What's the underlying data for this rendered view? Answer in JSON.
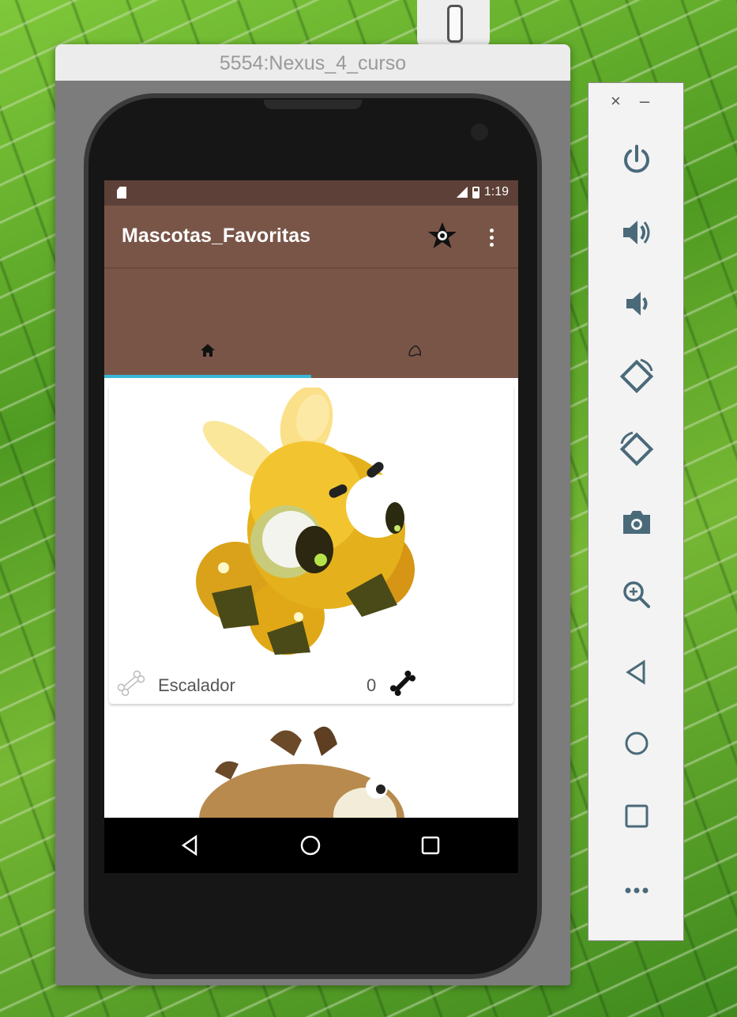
{
  "window": {
    "title": "5554:Nexus_4_curso"
  },
  "status_bar": {
    "time": "1:19"
  },
  "app": {
    "title": "Mascotas_Favoritas",
    "tabs": [
      {
        "icon": "home-icon"
      },
      {
        "icon": "paw-icon"
      }
    ],
    "selected_tab": 0
  },
  "pets": [
    {
      "name": "Escalador",
      "likes": "0"
    }
  ],
  "side_toolbar": {
    "buttons": [
      "close",
      "minimize",
      "power-icon",
      "volume-up-icon",
      "volume-down-icon",
      "rotate-left-icon",
      "rotate-right-icon",
      "camera-icon",
      "zoom-icon",
      "back-icon",
      "home-icon",
      "overview-icon",
      "more-icon"
    ]
  },
  "colors": {
    "primary": "#795548",
    "primary_dark": "#5d4037",
    "tab_indicator": "#38b6d6"
  }
}
